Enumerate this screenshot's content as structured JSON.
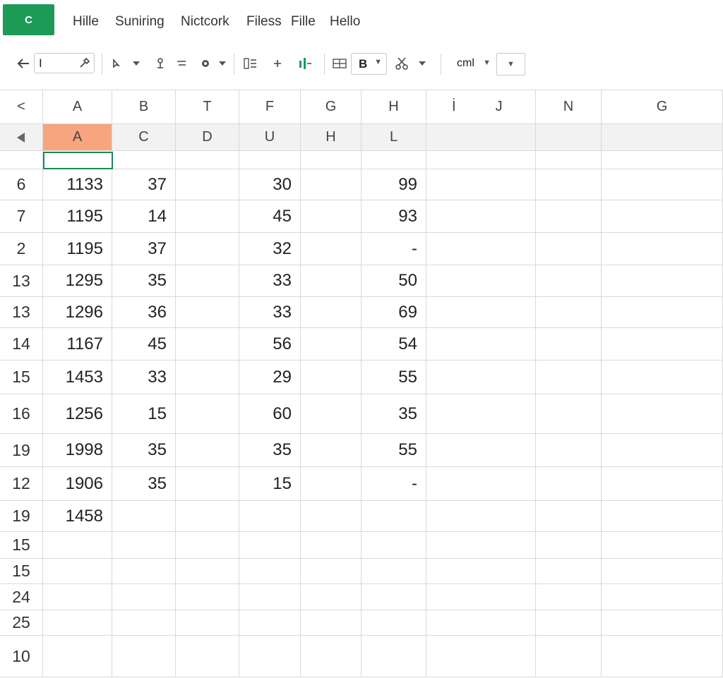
{
  "app": {
    "badge": "C",
    "accent": "#1e9a57"
  },
  "menu": [
    "Hille",
    "Suniring",
    "Nictcork",
    "Filess",
    "Fille",
    "Hello"
  ],
  "toolbar": {
    "name_box_value": "I",
    "font_style_value": "B",
    "zoom_value": "cml",
    "icons": [
      "back-arrow-icon",
      "eyedropper-icon",
      "cursor-icon",
      "chevron-down-icon",
      "paint-icon",
      "align-icon",
      "gear-icon",
      "list-icon",
      "plus-icon",
      "chart-icon",
      "table-icon",
      "scissors-icon"
    ]
  },
  "columns_row1": [
    "<",
    "A",
    "B",
    "T",
    "F",
    "G",
    "H",
    "İ",
    "J",
    "N",
    "G"
  ],
  "columns_row2": [
    "A",
    "C",
    "D",
    "U",
    "H",
    "L"
  ],
  "rows": [
    {
      "rn": "6",
      "a": "1133",
      "b": "37",
      "f": "30",
      "h": "99"
    },
    {
      "rn": "7",
      "a": "1195",
      "b": "14",
      "f": "45",
      "h": "93"
    },
    {
      "rn": "2",
      "a": "1195",
      "b": "37",
      "f": "32",
      "h": "-"
    },
    {
      "rn": "13",
      "a": "1295",
      "b": "35",
      "f": "33",
      "h": "50"
    },
    {
      "rn": "13",
      "a": "1296",
      "b": "36",
      "f": "33",
      "h": "69"
    },
    {
      "rn": "14",
      "a": "1167",
      "b": "45",
      "f": "56",
      "h": "54"
    },
    {
      "rn": "15",
      "a": "1453",
      "b": "33",
      "f": "29",
      "h": "55"
    },
    {
      "rn": "16",
      "a": "1256",
      "b": "15",
      "f": "60",
      "h": "35"
    },
    {
      "rn": "19",
      "a": "1998",
      "b": "35",
      "f": "35",
      "h": "55"
    },
    {
      "rn": "12",
      "a": "1906",
      "b": "35",
      "f": "15",
      "h": "-"
    },
    {
      "rn": "19",
      "a": "1458",
      "b": "",
      "f": "",
      "h": ""
    },
    {
      "rn": "15",
      "a": "",
      "b": "",
      "f": "",
      "h": ""
    },
    {
      "rn": "15",
      "a": "",
      "b": "",
      "f": "",
      "h": ""
    },
    {
      "rn": "24",
      "a": "",
      "b": "",
      "f": "",
      "h": ""
    },
    {
      "rn": "25",
      "a": "",
      "b": "",
      "f": "",
      "h": ""
    },
    {
      "rn": "10",
      "a": "",
      "b": "",
      "f": "",
      "h": ""
    }
  ]
}
